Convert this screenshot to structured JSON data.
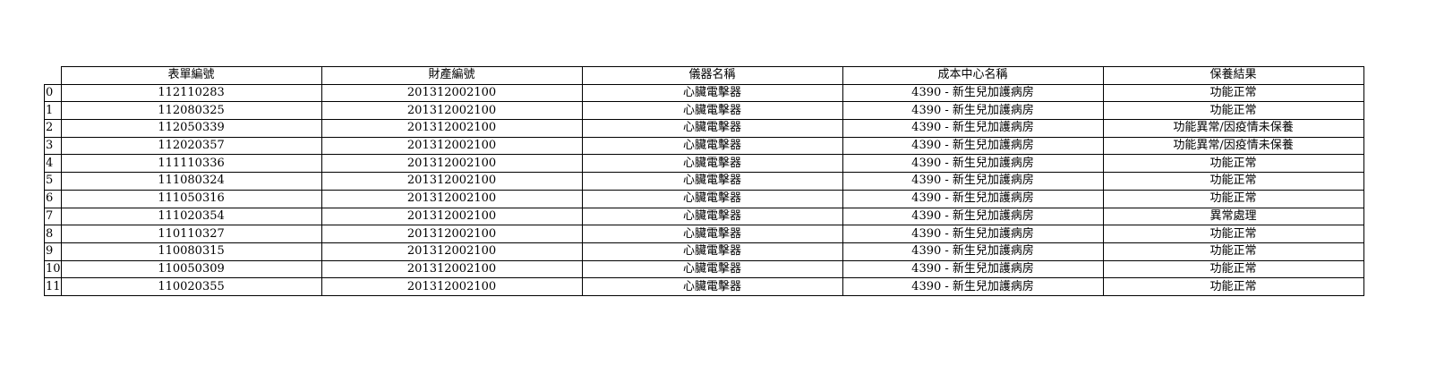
{
  "table": {
    "columns": [
      "表單編號",
      "財產編號",
      "儀器名稱",
      "成本中心名稱",
      "保養結果"
    ],
    "rows": [
      {
        "index": "0",
        "cells": [
          "112110283",
          "201312002100",
          "心臟電擊器",
          "4390 - 新生兒加護病房",
          "功能正常"
        ]
      },
      {
        "index": "1",
        "cells": [
          "112080325",
          "201312002100",
          "心臟電擊器",
          "4390 - 新生兒加護病房",
          "功能正常"
        ]
      },
      {
        "index": "2",
        "cells": [
          "112050339",
          "201312002100",
          "心臟電擊器",
          "4390 - 新生兒加護病房",
          "功能異常/因疫情未保養"
        ]
      },
      {
        "index": "3",
        "cells": [
          "112020357",
          "201312002100",
          "心臟電擊器",
          "4390 - 新生兒加護病房",
          "功能異常/因疫情未保養"
        ]
      },
      {
        "index": "4",
        "cells": [
          "111110336",
          "201312002100",
          "心臟電擊器",
          "4390 - 新生兒加護病房",
          "功能正常"
        ]
      },
      {
        "index": "5",
        "cells": [
          "111080324",
          "201312002100",
          "心臟電擊器",
          "4390 - 新生兒加護病房",
          "功能正常"
        ]
      },
      {
        "index": "6",
        "cells": [
          "111050316",
          "201312002100",
          "心臟電擊器",
          "4390 - 新生兒加護病房",
          "功能正常"
        ]
      },
      {
        "index": "7",
        "cells": [
          "111020354",
          "201312002100",
          "心臟電擊器",
          "4390 - 新生兒加護病房",
          "異常處理"
        ]
      },
      {
        "index": "8",
        "cells": [
          "110110327",
          "201312002100",
          "心臟電擊器",
          "4390 - 新生兒加護病房",
          "功能正常"
        ]
      },
      {
        "index": "9",
        "cells": [
          "110080315",
          "201312002100",
          "心臟電擊器",
          "4390 - 新生兒加護病房",
          "功能正常"
        ]
      },
      {
        "index": "10",
        "cells": [
          "110050309",
          "201312002100",
          "心臟電擊器",
          "4390 - 新生兒加護病房",
          "功能正常"
        ]
      },
      {
        "index": "11",
        "cells": [
          "110020355",
          "201312002100",
          "心臟電擊器",
          "4390 - 新生兒加護病房",
          "功能正常"
        ]
      }
    ]
  }
}
